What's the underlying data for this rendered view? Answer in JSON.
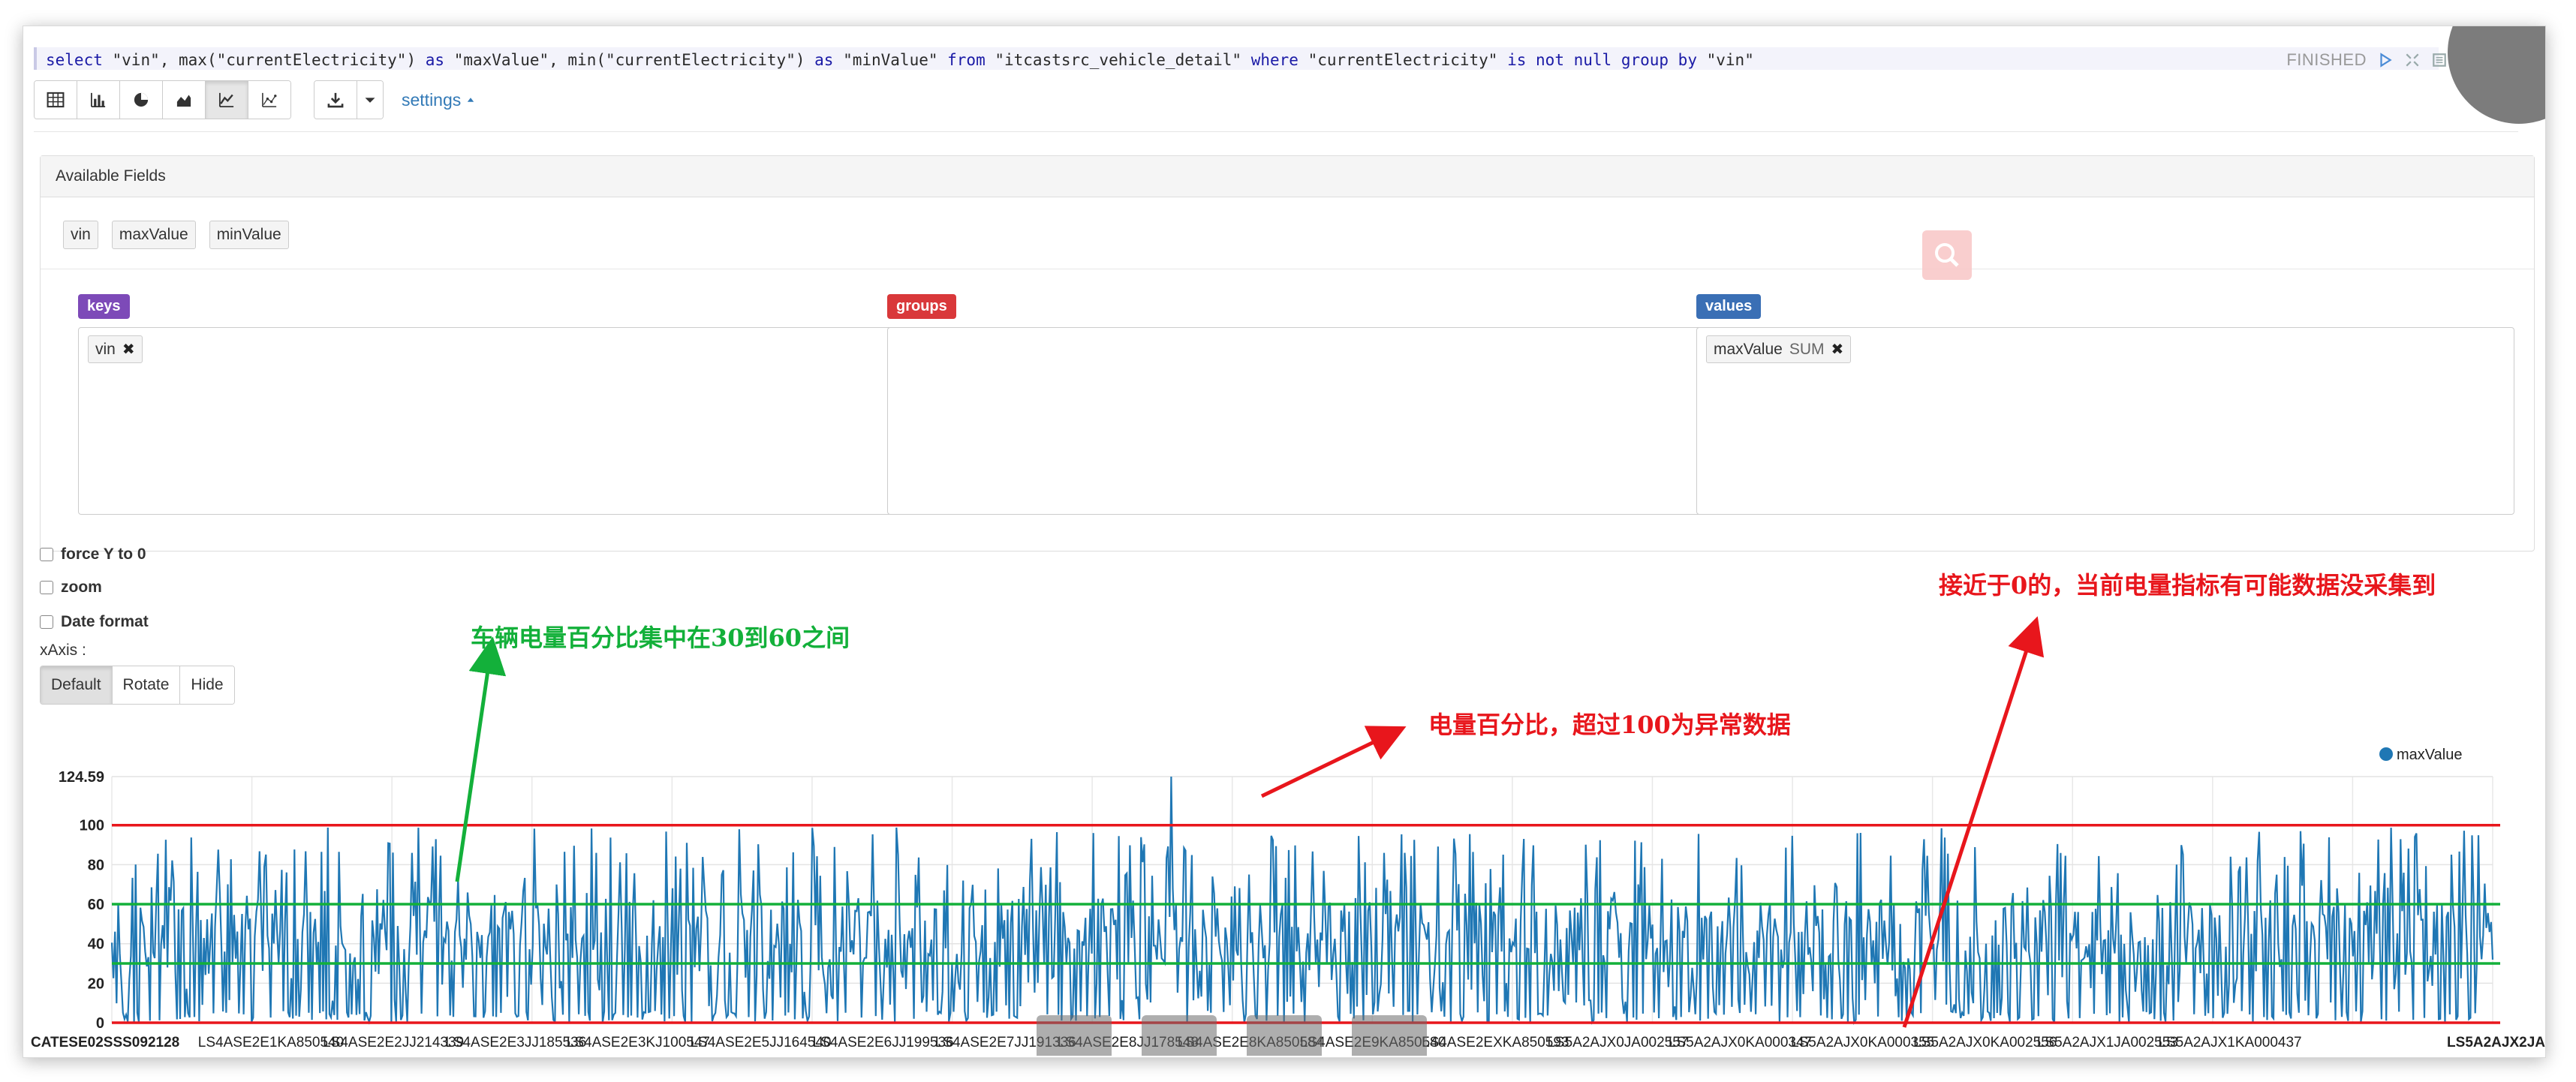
{
  "query": {
    "segments": [
      {
        "t": "select ",
        "k": true
      },
      {
        "t": "\"vin\", max(\"currentElectricity\") ",
        "k": false
      },
      {
        "t": "as ",
        "k": true
      },
      {
        "t": "\"maxValue\", min(\"currentElectricity\") ",
        "k": false
      },
      {
        "t": "as ",
        "k": true
      },
      {
        "t": "\"minValue\" ",
        "k": false
      },
      {
        "t": "from ",
        "k": true
      },
      {
        "t": "\"itcastsrc_vehicle_detail\" ",
        "k": false
      },
      {
        "t": "where ",
        "k": true
      },
      {
        "t": "\"currentElectricity\" ",
        "k": false
      },
      {
        "t": "is not null group by ",
        "k": true
      },
      {
        "t": "\"vin\"",
        "k": false
      }
    ]
  },
  "status": {
    "label": "FINISHED"
  },
  "toolbar": {
    "settings_label": "settings",
    "view_buttons": [
      "table-icon",
      "bar-chart-icon",
      "pie-chart-icon",
      "area-chart-icon",
      "line-chart-icon",
      "scatter-chart-icon"
    ],
    "active_view": 4
  },
  "panel": {
    "title": "Available Fields",
    "fields": [
      "vin",
      "maxValue",
      "minValue"
    ],
    "keys": {
      "label": "keys",
      "color": "#7d4ab8",
      "items": [
        "vin"
      ]
    },
    "groups": {
      "label": "groups",
      "color": "#d9383a",
      "items": []
    },
    "values": {
      "label": "values",
      "color": "#3a6fb5",
      "items": [
        {
          "name": "maxValue",
          "agg": "SUM"
        }
      ]
    }
  },
  "options": {
    "force_y": "force Y to 0",
    "zoom": "zoom",
    "date_format": "Date format",
    "xaxis_label": "xAxis :",
    "xaxis_modes": [
      "Default",
      "Rotate",
      "Hide"
    ],
    "xaxis_active": 0
  },
  "annotations": {
    "green_note": "车辆电量百分比集中在30到60之间",
    "red_note_mid": "电量百分比，超过100为异常数据",
    "red_note_right": "接近于0的，当前电量指标有可能数据没采集到"
  },
  "chart_data": {
    "type": "line",
    "series": [
      {
        "name": "maxValue",
        "color": "#1f77b4"
      }
    ],
    "y_ticks": [
      0,
      20,
      40,
      60,
      80,
      100,
      124.59
    ],
    "ylim": [
      0,
      124.59
    ],
    "x_tick_labels": [
      "CATESE02SSS092128",
      "LS4ASE2E1KA850540",
      "LS4ASE2E2JJ214339",
      "LS4ASE2E3JJ185536",
      "LS4ASE2E3KJ100547",
      "LS4ASE2E5JJ164540",
      "LS4ASE2E6JJ199536",
      "LS4ASE2E7JJ191336",
      "LS4ASE2E8JJ178548",
      "LS4ASE2E8KA850584",
      "LS4ASE2E9KA850540",
      "LS4ASE2EXKA850593",
      "LS5A2AJX0JA002557",
      "LS5A2AJX0KA000347",
      "LS5A2AJX0KA000355",
      "LS5A2AJX0KA002556",
      "LS5A2AJX1JA002553",
      "LS5A2AJX1KA000437",
      "LS5A2AJX2JA"
    ],
    "reference_lines": [
      {
        "y": 100,
        "color": "#e8161c"
      },
      {
        "y": 60,
        "color": "#13b03a"
      },
      {
        "y": 30,
        "color": "#13b03a"
      },
      {
        "y": 0,
        "color": "#e8161c"
      }
    ],
    "peak": {
      "value": 124.59,
      "position": 0.445
    }
  }
}
